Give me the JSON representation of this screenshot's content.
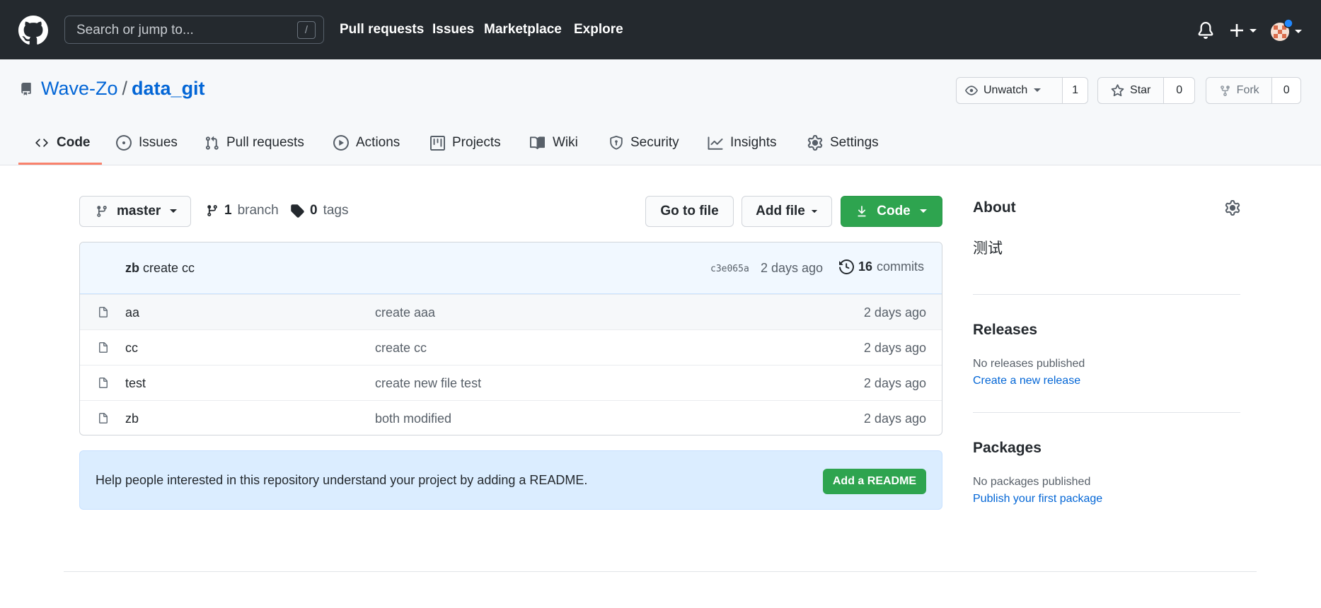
{
  "header": {
    "search_placeholder": "Search or jump to...",
    "search_shortcut": "/",
    "nav": [
      "Pull requests",
      "Issues",
      "Marketplace",
      "Explore"
    ]
  },
  "repo": {
    "owner": "Wave-Zo",
    "separator": "/",
    "name": "data_git",
    "watch": {
      "label": "Unwatch",
      "count": "1"
    },
    "star": {
      "label": "Star",
      "count": "0"
    },
    "fork": {
      "label": "Fork",
      "count": "0"
    }
  },
  "tabs": [
    {
      "label": "Code",
      "icon": "code-icon"
    },
    {
      "label": "Issues",
      "icon": "issue-icon"
    },
    {
      "label": "Pull requests",
      "icon": "pull-request-icon"
    },
    {
      "label": "Actions",
      "icon": "play-icon"
    },
    {
      "label": "Projects",
      "icon": "project-icon"
    },
    {
      "label": "Wiki",
      "icon": "book-icon"
    },
    {
      "label": "Security",
      "icon": "shield-icon"
    },
    {
      "label": "Insights",
      "icon": "graph-icon"
    },
    {
      "label": "Settings",
      "icon": "gear-icon"
    }
  ],
  "toolbar": {
    "branch": "master",
    "branch_count": "1",
    "branch_word": "branch",
    "tag_count": "0",
    "tag_word": "tags",
    "go_to_file": "Go to file",
    "add_file": "Add file",
    "code": "Code"
  },
  "latest_commit": {
    "author": "zb",
    "message": "create cc",
    "sha": "c3e065a",
    "age": "2 days ago",
    "count": "16",
    "count_word": "commits"
  },
  "files": [
    {
      "name": "aa",
      "message": "create aaa",
      "age": "2 days ago"
    },
    {
      "name": "cc",
      "message": "create cc",
      "age": "2 days ago"
    },
    {
      "name": "test",
      "message": "create new file test",
      "age": "2 days ago"
    },
    {
      "name": "zb",
      "message": "both modified",
      "age": "2 days ago"
    }
  ],
  "readme_prompt": {
    "text": "Help people interested in this repository understand your project by adding a README.",
    "button": "Add a README"
  },
  "sidebar": {
    "about_title": "About",
    "description": "测试",
    "releases_title": "Releases",
    "releases_empty": "No releases published",
    "releases_link": "Create a new release",
    "packages_title": "Packages",
    "packages_empty": "No packages published",
    "packages_link": "Publish your first package"
  },
  "colors": {
    "header_bg": "#24292e",
    "link": "#0366d6",
    "primary_green": "#2ea44f",
    "tab_underline": "#f9826c",
    "notice_blue": "#dbedff"
  }
}
